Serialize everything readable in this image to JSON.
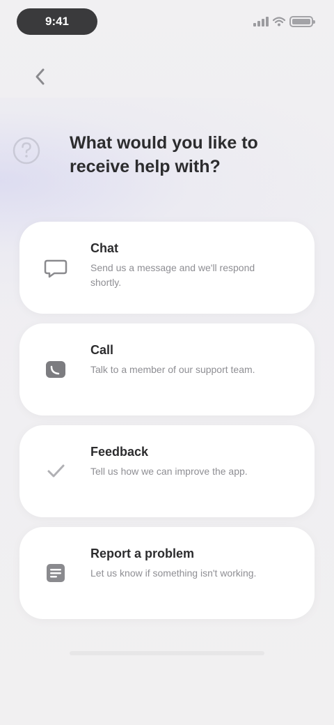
{
  "status_bar": {
    "time": "9:41"
  },
  "header": {
    "title": "What would you like to receive help with?"
  },
  "options": [
    {
      "title": "Chat",
      "description": "Send us a message and we'll respond shortly.",
      "icon": "chat-bubble-icon"
    },
    {
      "title": "Call",
      "description": "Talk to a member of our support team.",
      "icon": "phone-icon"
    },
    {
      "title": "Feedback",
      "description": "Tell us how we can improve the app.",
      "icon": "feedback-icon"
    },
    {
      "title": "Report a problem",
      "description": "Let us know if something isn't working.",
      "icon": "report-icon"
    }
  ],
  "colors": {
    "background": "#f1f0f2",
    "card": "#ffffff",
    "text_primary": "#2c2c2e",
    "text_secondary": "#8e8e93",
    "icon": "#6b6b70"
  }
}
